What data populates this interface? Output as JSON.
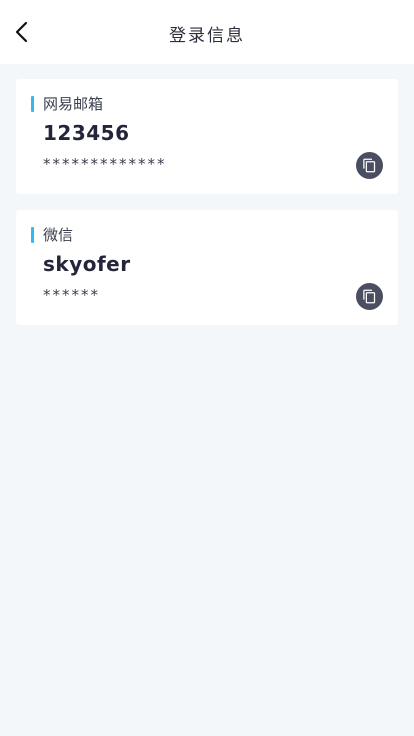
{
  "header": {
    "title": "登录信息",
    "back_icon": "chevron-left-icon"
  },
  "accounts": [
    {
      "label": "网易邮箱",
      "account": "123456",
      "password_masked": "*************",
      "copy_icon": "copy-icon"
    },
    {
      "label": "微信",
      "account": "skyofer",
      "password_masked": "******",
      "copy_icon": "copy-icon"
    }
  ],
  "colors": {
    "accent": "#35b9ea",
    "page_background": "#f4f7fa",
    "copy_button": "#4a4e60"
  }
}
